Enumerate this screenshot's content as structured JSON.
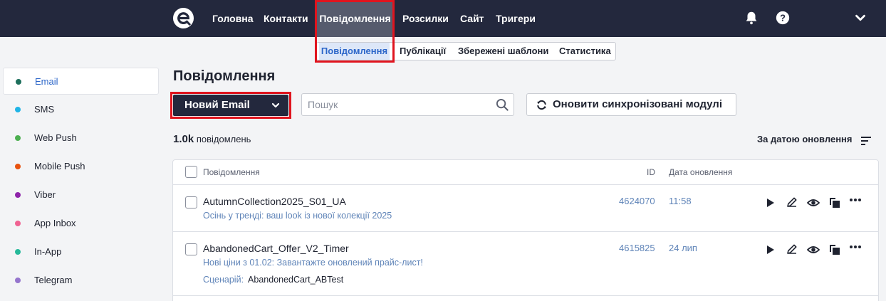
{
  "nav": {
    "items": [
      "Головна",
      "Контакти",
      "Повідомлення",
      "Розсилки",
      "Сайт",
      "Тригери"
    ],
    "active": "Повідомлення",
    "icons": [
      "bell-icon",
      "help-icon",
      "chevron-down-icon"
    ]
  },
  "subnav": {
    "items": [
      "Повідомлення",
      "Публікації",
      "Збережені шаблони",
      "Статистика"
    ],
    "active": "Повідомлення"
  },
  "sidebar": {
    "items": [
      {
        "label": "Email",
        "color": "#1e6f5c"
      },
      {
        "label": "SMS",
        "color": "#1fb4e6"
      },
      {
        "label": "Web Push",
        "color": "#4caf50"
      },
      {
        "label": "Mobile Push",
        "color": "#e8520f"
      },
      {
        "label": "Viber",
        "color": "#8e24aa"
      },
      {
        "label": "App Inbox",
        "color": "#f06292"
      },
      {
        "label": "In-App",
        "color": "#26b99a"
      },
      {
        "label": "Telegram",
        "color": "#9575cd"
      }
    ],
    "active": "Email"
  },
  "main": {
    "title": "Повідомлення",
    "new_button": "Новий Email",
    "search_placeholder": "Пошук",
    "sync_button": "Оновити синхронізовані модулі",
    "count_value": "1.0k",
    "count_label": "повідомлень",
    "sort_label": "За датою оновлення"
  },
  "table": {
    "headers": {
      "name": "Повідомлення",
      "id": "ID",
      "date": "Дата оновлення"
    },
    "rows": [
      {
        "name": "AutumnCollection2025_S01_UA",
        "subject": "Осінь у тренді: ваш look із нової колекції 2025",
        "id": "4624070",
        "date": "11:58"
      },
      {
        "name": "AbandonedCart_Offer_V2_Timer",
        "subject": "Нові ціни з 01.02: Завантажте оновлений прайс-лист!",
        "id": "4615825",
        "date": "24 лип",
        "scenario_label": "Сценарій:",
        "scenario_value": "AbandonedCart_ABTest"
      }
    ],
    "row_actions": [
      "play-icon",
      "edit-icon",
      "preview-icon",
      "copy-icon",
      "more-icon"
    ]
  },
  "colors": {
    "topbar": "#23283d",
    "accent": "#2c66c9",
    "highlight": "#e0141e",
    "link": "#5f84b8"
  }
}
